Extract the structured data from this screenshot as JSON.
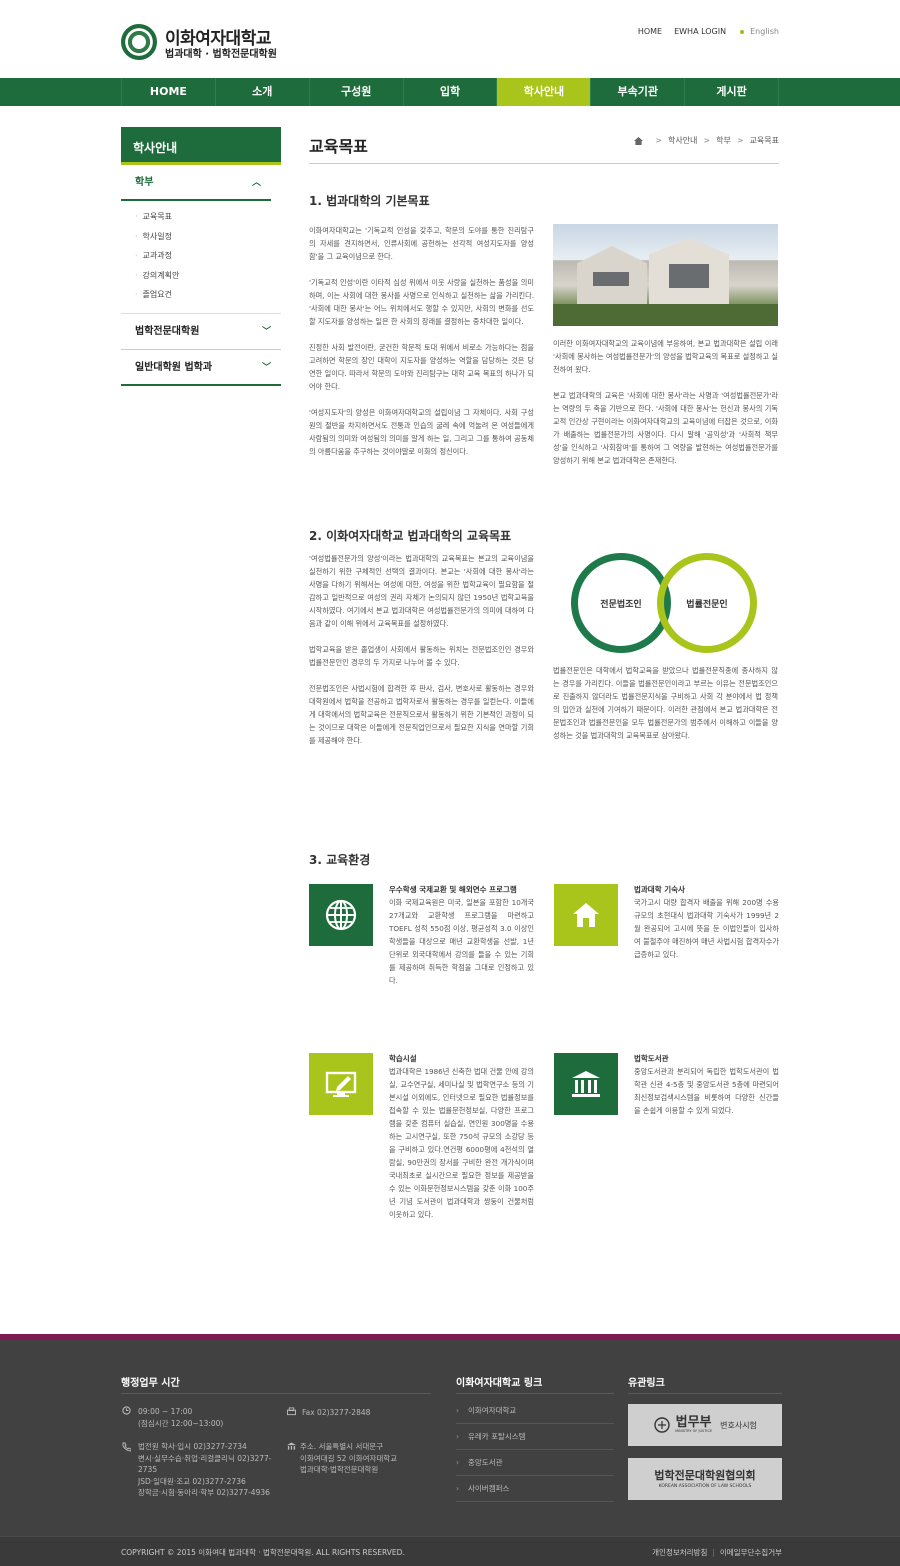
{
  "header": {
    "logo_main": "이화여자대학교",
    "logo_sub": "법과대학 · 법학전문대학원",
    "util_home": "HOME",
    "util_login": "EWHA LOGIN",
    "util_english": "English"
  },
  "gnb": [
    "HOME",
    "소개",
    "구성원",
    "입학",
    "학사안내",
    "부속기관",
    "게시판"
  ],
  "lnb": {
    "title": "학사안내",
    "section1": "학부",
    "sub": [
      "교육목표",
      "학사일정",
      "교과과정",
      "강의계획안",
      "졸업요건"
    ],
    "section2": "법학전문대학원",
    "section3": "일반대학원 법학과"
  },
  "page": {
    "title": "교육목표",
    "crumb": [
      "학사안내",
      "학부",
      "교육목표"
    ]
  },
  "s1": {
    "heading": "1. 법과대학의 기본목표",
    "left": [
      "이화여자대학교는 '기독교적 인성을 갖추고, 학문의 도야를 통한 진리탐구의 자세를 견지하면서, 인류사회에 공헌하는 선각적 여성지도자를 양성함'을 그 교육이념으로 한다.",
      "'기독교적 인성'이란 이타적 심성 위에서 이웃 사랑을 실천하는 품성을 의미하며, 이는 사회에 대한 봉사를 사명으로 인식하고 실천하는 삶을 가리킨다. '사회에 대한 봉사'는 어느 위치에서도 행할 수 있지만, 사회의 변화를 선도할 지도자를 양성하는 일은 한 사회의 장래를 결정하는 중차대한 일이다.",
      "진정한 사회 발전이란, 굳건한 학문적 토대 위에서 비로소 가능하다는 점을 고려하면 학문의 장인 대학이 지도자를 양성하는 역할을 담당하는 것은 당연한 일이다. 따라서 학문의 도야와 진리탐구는 대학 교육 목표의 하나가 되어야 한다.",
      "'여성지도자'의 양성은 이화여자대학교의 설립이념 그 자체이다. 사회 구성원의 절반을 차지하면서도 전통과 인습의 굴레 속에 억눌려 온 여성들에게 사람됨의 의미와 여성됨의 의미를 알게 하는 일, 그리고 그를 통하여 공동체의 아름다움을 추구하는 것이야말로 이화의 정신이다."
    ],
    "right": [
      "이러한 이화여자대학교의 교육이념에 부응하여, 본교 법과대학은 설립 이래 '사회에 봉사하는 여성법률전문가'의 양성을 법학교육의 목표로 설정하고 실천하여 왔다.",
      "본교 법과대학의 교육은 '사회에 대한 봉사'라는 사명과 '여성법률전문가'라는 역량의 두 축을 기반으로 한다. '사회에 대한 봉사'는 헌신과 봉사의 기독교적 인간상 구현이라는 이화여자대학교의 교육이념에 터잡은 것으로, 이화가 배출하는 법률전문가의 사명이다. 다시 말해 '공익성'과 '사회적 책무성'을 인식하고 '사회참여'를 통하여 그 역량을 발현하는 여성법률전문가를 양성하기 위해 본교 법과대학은 존재한다."
    ]
  },
  "s2": {
    "heading": "2. 이화여자대학교 법과대학의 교육목표",
    "left": [
      "'여성법률전문가의 양성'이라는 법과대학의 교육목표는 본교의 교육이념을 실천하기 위한 구체적인 선택의 결과이다. 본교는 '사회에 대한 봉사'라는 사명을 다하기 위해서는 여성에 대한, 여성을 위한 법학교육이 필요함을 절감하고 일반적으로 여성의 권리 자체가 논의되지 않던 1950년 법학교육을 시작하였다. 여기에서 본교 법과대학은 여성법률전문가의 의미에 대하여 다음과 같이 이해 위에서 교육목표를 설정하였다.",
      "법학교육을 받은 졸업생이 사회에서 활동하는 위치는 전문법조인인 경우와 법률전문인인 경우의 두 가지로 나누어 볼 수 있다.",
      "전문법조인은 사법시험에 합격한 후 판사, 검사, 변호사로 활동하는 경우와 대학원에서 법학을 전공하고 법학자로서 활동하는 경우를 일컫는다. 이들에게 대학에서의 법학교육은 전문직으로서 활동하기 위한 기본적인 과정이 되는 것이므로 대학은 이들에게 전문직업인으로서 필요한 지식을 연마할 기회를 제공해야 한다."
    ],
    "circle1": "전문법조인",
    "circle2": "법률전문인",
    "right": "법률전문인은 대학에서 법학교육을 받았으나 법률전문직종에 종사하지 않는 경우를 가리킨다. 이들을 법률전문인이라고 부르는 이유는 전문법조인으로 진출하지 않더라도 법률전문지식을 구비하고 사회 각 분야에서 법 정책의 입안과 실천에 기여하기 때문이다. 이러한 관점에서 본교 법과대학은 전문법조인과 법률전문인을 모두 법률전문가의 범주에서 이해하고 이들을 양성하는 것을 법과대학의 교육목표로 삼아왔다."
  },
  "s3": {
    "heading": "3. 교육환경",
    "items": [
      {
        "title": "우수학생 국제교환 및 해외연수 프로그램",
        "icon": "globe-icon",
        "desc": "이화 국제교육원은 미국, 일본을 포함한 10개국 27개교와 교환학생 프로그램을 마련하고 TOEFL 성적 550점 이상, 평균성적 3.0 이상인 학생들을 대상으로 매년 교환학생을 선발, 1년 단위로 외국대학에서 강의를 들을 수 있는 기회를 제공하며 취득한 학점을 그대로 인정하고 있다."
      },
      {
        "title": "법과대학 기숙사",
        "icon": "house-icon",
        "desc": "국가고시 대량 합격자 배출을 위해 200명 수용규모의 초현대식 법과대학 기숙사가 1999년 2월 완공되어 고시에 뜻을 둔 이법인들이 입사하여 불철주야 매진하여 매년 사법시험 합격자수가 급증하고 있다."
      },
      {
        "title": "학습시설",
        "icon": "monitor-pen-icon",
        "desc": "법과대학은 1986년 신축한 법대 건물 안에 강의실, 교수연구실, 세미나실 및 법학연구소 등의 기본시설 이외에도, 인터넷으로 필요한 법률정보를 접속할 수 있는 법률문헌정보실, 다양한 프로그램을 갖춘 컴퓨터 실습실, 연인원 300명을 수용하는 고시연구실, 또한 750석 규모의 소강당 등을 구비하고 있다.연건평 6000평에 4천석의 열람실, 90만권의 장서를 구비한 완전 개가식이며 국내최초로 실시간으로 필요한 정보를 제공받을 수 있는 이화문헌정보시스템을 갖춘 이화 100주년 기념 도서관이 법과대학과 쌍둥이 건물처럼 이웃하고 있다."
      },
      {
        "title": "법학도서관",
        "icon": "library-icon",
        "desc": "중앙도서관과 분리되어 독립한 법학도서관이 법학관 신관 4-5층 및 중앙도서관 5층에 마련되어 최신정보검색시스템을 비롯하여 다양한 신간들을 손쉽게 이용할 수 있게 되었다."
      }
    ]
  },
  "footer": {
    "hours_title": "행정업무 시간",
    "hours": "09:00 ~ 17:00",
    "lunch": "(점심시간 12:00~13:00)",
    "fax": "Fax 02)3277-2848",
    "phone_lines": [
      "법전원 학사·입시 02)3277-2734",
      "변시·실무수습·취업·리걸클리닉 02)3277-",
      "2735",
      "JSD·일대원·조교 02)3277-2736",
      "장학금·시험·동아리·학부 02)3277-4936"
    ],
    "addr_lines": [
      "주소. 서울특별시 서대문구",
      "이화여대길 52 이화여자대학교",
      "법과대학·법학전문대학원"
    ],
    "links_title": "이화여자대학교 링크",
    "links": [
      "이화여자대학교",
      "유레카 포탈시스템",
      "중앙도서관",
      "사이버캠퍼스"
    ],
    "related_title": "유관링크",
    "banner1_main": "법무부",
    "banner1_sub": "MINISTRY OF JUSTICE",
    "banner1_side": "변호사시험",
    "banner2_main": "법학전문대학원협의회",
    "banner2_sub": "KOREAN ASSOCIATION OF LAW SCHOOLS",
    "copyright": "COPYRIGHT © 2015 이화여대 법과대학 · 법학전문대학원. ALL RIGHTS RESERVED.",
    "privacy": "개인정보처리방침",
    "email_policy": "이메일무단수집거부"
  },
  "colors": {
    "green": "#1e6b3c",
    "lime": "#a9c41a",
    "footer": "#414141",
    "accent": "#7d1a4f"
  }
}
